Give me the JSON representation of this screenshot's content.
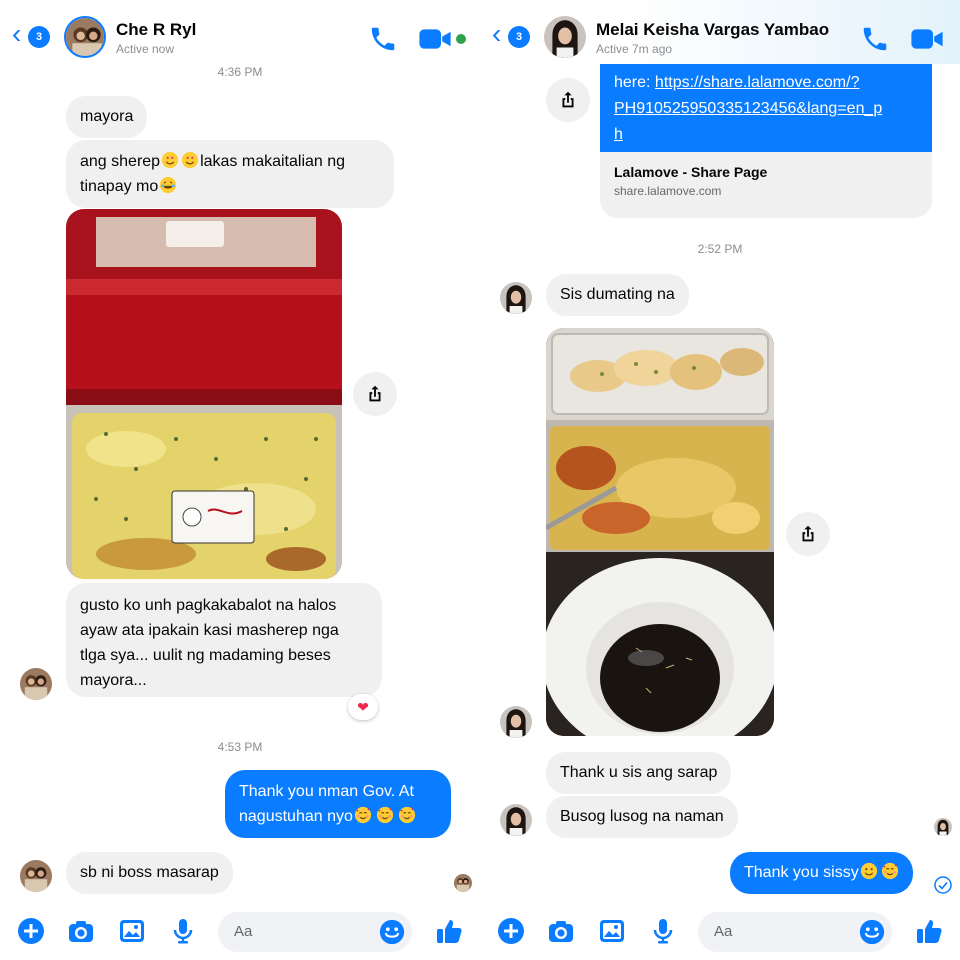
{
  "left": {
    "header": {
      "back_badge": "3",
      "name": "Che R Ryl",
      "status": "Active now"
    },
    "messages": {
      "ts1": "4:36 PM",
      "m1": "mayora",
      "m2a": "ang sherep",
      "m2b": "lakas makaitalian ng",
      "m2c": "tinapay mo",
      "m3_lines": [
        "gusto ko unh pagkakabalot na halos",
        "ayaw ata ipakain kasi masherep nga",
        "tlga sya... uulit ng madaming beses",
        "mayora..."
      ],
      "reaction": "❤",
      "ts2": "4:53 PM",
      "m4_line1": "Thank you nman Gov. At",
      "m4_line2": "nagustuhan nyo",
      "m5": "sb ni boss masarap"
    },
    "composer": {
      "placeholder": "Aa"
    }
  },
  "right": {
    "header": {
      "back_badge": "3",
      "name": "Melai Keisha Vargas Yambao",
      "status": "Active 7m ago"
    },
    "link": {
      "prefix": "here: ",
      "url_line1": "https://share.lalamove.com/?",
      "url_line2": "PH910525950335123456&lang=en_p",
      "url_line3": "h",
      "title": "Lalamove - Share Page",
      "domain": "share.lalamove.com"
    },
    "messages": {
      "ts1": "2:52 PM",
      "m1": "Sis dumating na",
      "m2": "Thank u sis ang sarap",
      "m3": "Busog lusog na naman",
      "m4": "Thank you sissy"
    },
    "composer": {
      "placeholder": "Aa"
    }
  },
  "colors": {
    "accent": "#0a7cff",
    "bubble_in": "#f0f0f0",
    "online": "#31a24c",
    "meta_text": "#8a8d91"
  },
  "icons": [
    "back-chevron-icon",
    "phone-icon",
    "video-camera-icon",
    "share-icon",
    "heart-icon",
    "plus-circle-icon",
    "camera-icon",
    "gallery-icon",
    "microphone-icon",
    "emoji-icon",
    "thumbs-up-icon",
    "read-check-icon"
  ]
}
